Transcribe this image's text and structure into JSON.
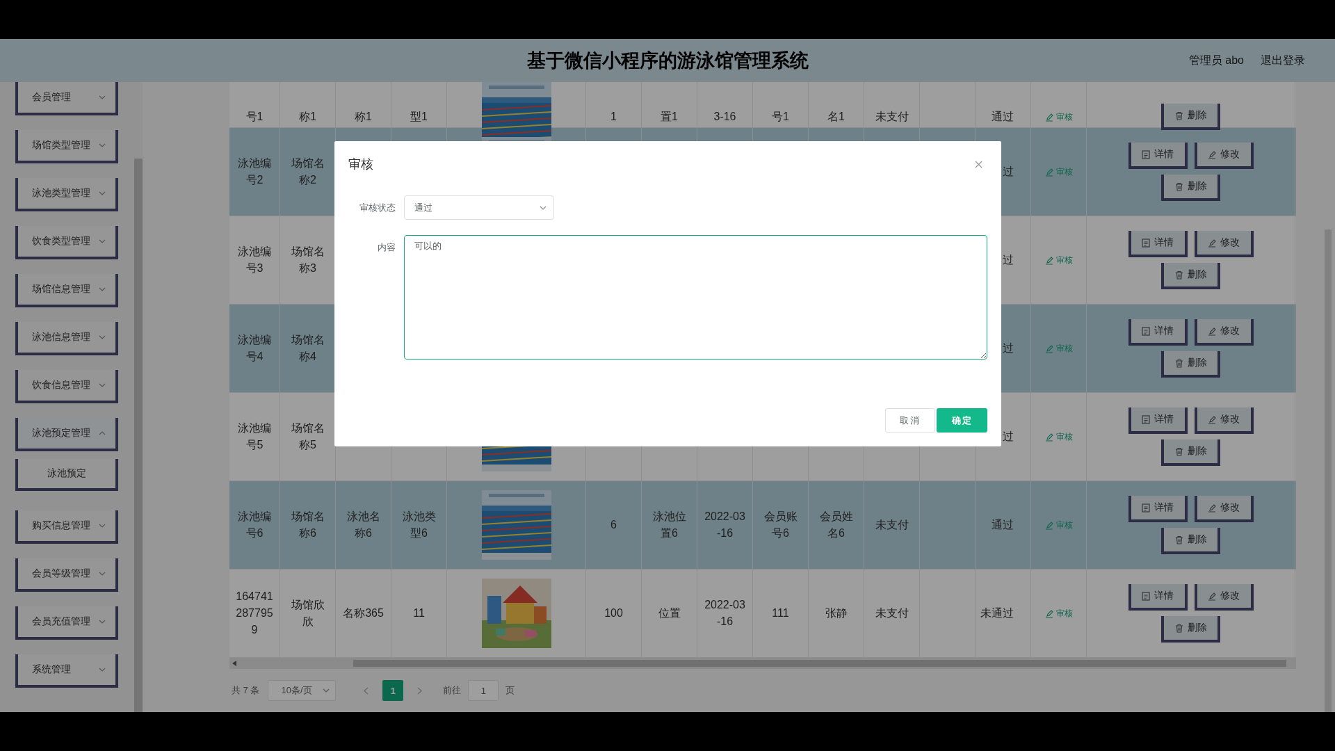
{
  "header": {
    "title": "基于微信小程序的游泳馆管理系统",
    "user": "管理员 abo",
    "logout": "退出登录"
  },
  "sidebar": {
    "items": [
      {
        "label": "会员管理",
        "expanded": false
      },
      {
        "label": "场馆类型管理",
        "expanded": false
      },
      {
        "label": "泳池类型管理",
        "expanded": false
      },
      {
        "label": "饮食类型管理",
        "expanded": false
      },
      {
        "label": "场馆信息管理",
        "expanded": false
      },
      {
        "label": "泳池信息管理",
        "expanded": false
      },
      {
        "label": "饮食信息管理",
        "expanded": false
      },
      {
        "label": "泳池预定管理",
        "expanded": true,
        "children": [
          {
            "label": "泳池预定"
          }
        ]
      },
      {
        "label": "购买信息管理",
        "expanded": false
      },
      {
        "label": "会员等级管理",
        "expanded": false
      },
      {
        "label": "会员充值管理",
        "expanded": false
      },
      {
        "label": "系统管理",
        "expanded": false
      }
    ]
  },
  "table": {
    "rows": [
      {
        "cells": [
          {
            "text": "号1"
          },
          {
            "text": "称1"
          },
          {
            "text": "称1"
          },
          {
            "text": "型1"
          },
          {
            "kind": "picture"
          },
          {
            "text": "1"
          },
          {
            "text": "置1"
          },
          {
            "text": "3-16"
          },
          {
            "text": "号1"
          },
          {
            "text": "名1"
          },
          {
            "text": "未支付"
          },
          {},
          {
            "text": "通过"
          },
          {
            "kind": "link",
            "text": "审核"
          }
        ],
        "actions": [
          {
            "kind": "delete",
            "label": "删除"
          }
        ]
      },
      {
        "cells": [
          {
            "text": "泳池编号2"
          },
          {
            "text": "场馆名称2"
          },
          {},
          {},
          {
            "kind": "picture"
          },
          {},
          {},
          {},
          {},
          {},
          {},
          {},
          {
            "text": "过"
          },
          {
            "kind": "link",
            "text": "审核"
          }
        ],
        "actions": [
          {
            "kind": "detail",
            "label": "详情"
          },
          {
            "kind": "edit",
            "label": "修改"
          },
          {
            "kind": "delete",
            "label": "删除"
          }
        ]
      },
      {
        "cells": [
          {
            "text": "泳池编号3"
          },
          {
            "text": "场馆名称3"
          },
          {},
          {},
          {},
          {},
          {},
          {},
          {},
          {},
          {},
          {},
          {
            "text": "过"
          },
          {
            "kind": "link",
            "text": "审核"
          }
        ],
        "actions": [
          {
            "kind": "detail",
            "label": "详情"
          },
          {
            "kind": "edit",
            "label": "修改"
          },
          {
            "kind": "delete",
            "label": "删除"
          }
        ]
      },
      {
        "cells": [
          {
            "text": "泳池编号4"
          },
          {
            "text": "场馆名称4"
          },
          {},
          {},
          {},
          {},
          {},
          {},
          {},
          {},
          {},
          {},
          {
            "text": "过"
          },
          {
            "kind": "link",
            "text": "审核"
          }
        ],
        "actions": [
          {
            "kind": "detail",
            "label": "详情"
          },
          {
            "kind": "edit",
            "label": "修改"
          },
          {
            "kind": "delete",
            "label": "删除"
          }
        ]
      },
      {
        "cells": [
          {
            "text": "泳池编号5"
          },
          {
            "text": "场馆名称5"
          },
          {},
          {},
          {
            "kind": "picture"
          },
          {},
          {},
          {},
          {},
          {},
          {},
          {},
          {
            "text": "过"
          },
          {
            "kind": "link",
            "text": "审核"
          }
        ],
        "actions": [
          {
            "kind": "detail",
            "label": "详情"
          },
          {
            "kind": "edit",
            "label": "修改"
          },
          {
            "kind": "delete",
            "label": "删除"
          }
        ]
      },
      {
        "cells": [
          {
            "text": "泳池编号6"
          },
          {
            "text": "场馆名称6"
          },
          {
            "text": "泳池名称6"
          },
          {
            "text": "泳池类型6"
          },
          {
            "kind": "picture"
          },
          {
            "text": "6"
          },
          {
            "text": "泳池位置6"
          },
          {
            "text": "2022-03-16"
          },
          {
            "text": "会员账号6"
          },
          {
            "text": "会员姓名6"
          },
          {
            "text": "未支付"
          },
          {},
          {
            "text": "通过"
          },
          {
            "kind": "link",
            "text": "审核"
          }
        ],
        "actions": [
          {
            "kind": "detail",
            "label": "详情"
          },
          {
            "kind": "edit",
            "label": "修改"
          },
          {
            "kind": "delete",
            "label": "删除"
          }
        ]
      },
      {
        "cells": [
          {
            "text": "1647412877959"
          },
          {
            "text": "场馆欣欣"
          },
          {
            "text": "名称365"
          },
          {
            "text": "11"
          },
          {
            "kind": "picture"
          },
          {
            "text": "100"
          },
          {
            "text": "位置"
          },
          {
            "text": "2022-03-16"
          },
          {
            "text": "111"
          },
          {
            "text": "张静"
          },
          {
            "text": "未支付"
          },
          {},
          {
            "text": "未通过"
          },
          {
            "kind": "link",
            "text": "审核"
          }
        ],
        "actions": [
          {
            "kind": "detail",
            "label": "详情"
          },
          {
            "kind": "edit",
            "label": "修改"
          },
          {
            "kind": "delete",
            "label": "删除"
          }
        ]
      }
    ]
  },
  "pager": {
    "total": "共 7 条",
    "page_size": "10条/页",
    "pages": [
      {
        "label": "1",
        "selected": true
      }
    ],
    "goto": "前往",
    "goto_value": "1",
    "page_unit": "页"
  },
  "dialog": {
    "title": "审核",
    "fields": [
      {
        "kind": "select",
        "label": "审核状态",
        "value": "通过"
      },
      {
        "kind": "textarea",
        "label": "内容",
        "value": "可以的"
      }
    ],
    "buttons": [
      {
        "kind": "cancel",
        "label": "取消"
      },
      {
        "kind": "confirm",
        "label": "确定"
      }
    ]
  }
}
